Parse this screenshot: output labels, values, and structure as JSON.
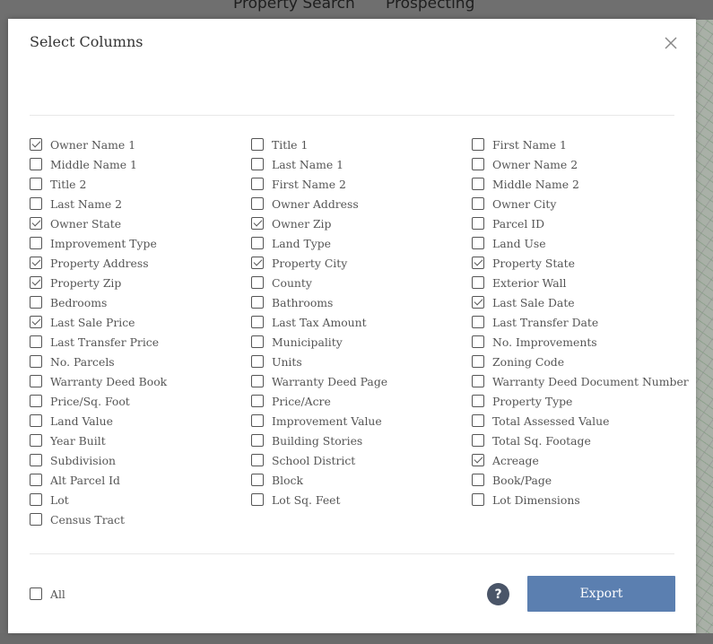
{
  "background": {
    "nav_links": [
      "Property Search",
      "Prospecting"
    ]
  },
  "modal": {
    "title": "Select Columns",
    "close_icon": "close-icon"
  },
  "columns": [
    [
      {
        "label": "Owner Name 1",
        "checked": true
      },
      {
        "label": "Middle Name 1",
        "checked": false
      },
      {
        "label": "Title 2",
        "checked": false
      },
      {
        "label": "Last Name 2",
        "checked": false
      },
      {
        "label": "Owner State",
        "checked": true
      },
      {
        "label": "Improvement Type",
        "checked": false
      },
      {
        "label": "Property Address",
        "checked": true
      },
      {
        "label": "Property Zip",
        "checked": true
      },
      {
        "label": "Bedrooms",
        "checked": false
      },
      {
        "label": "Last Sale Price",
        "checked": true
      },
      {
        "label": "Last Transfer Price",
        "checked": false
      },
      {
        "label": "No. Parcels",
        "checked": false
      },
      {
        "label": "Warranty Deed Book",
        "checked": false
      },
      {
        "label": "Price/Sq. Foot",
        "checked": false
      },
      {
        "label": "Land Value",
        "checked": false
      },
      {
        "label": "Year Built",
        "checked": false
      },
      {
        "label": "Subdivision",
        "checked": false
      },
      {
        "label": "Alt Parcel Id",
        "checked": false
      },
      {
        "label": "Lot",
        "checked": false
      },
      {
        "label": "Census Tract",
        "checked": false
      }
    ],
    [
      {
        "label": "Title 1",
        "checked": false
      },
      {
        "label": "Last Name 1",
        "checked": false
      },
      {
        "label": "First Name 2",
        "checked": false
      },
      {
        "label": "Owner Address",
        "checked": false
      },
      {
        "label": "Owner Zip",
        "checked": true
      },
      {
        "label": "Land Type",
        "checked": false
      },
      {
        "label": "Property City",
        "checked": true
      },
      {
        "label": "County",
        "checked": false
      },
      {
        "label": "Bathrooms",
        "checked": false
      },
      {
        "label": "Last Tax Amount",
        "checked": false
      },
      {
        "label": "Municipality",
        "checked": false
      },
      {
        "label": "Units",
        "checked": false
      },
      {
        "label": "Warranty Deed Page",
        "checked": false
      },
      {
        "label": "Price/Acre",
        "checked": false
      },
      {
        "label": "Improvement Value",
        "checked": false
      },
      {
        "label": "Building Stories",
        "checked": false
      },
      {
        "label": "School District",
        "checked": false
      },
      {
        "label": "Block",
        "checked": false
      },
      {
        "label": "Lot Sq. Feet",
        "checked": false
      }
    ],
    [
      {
        "label": "First Name 1",
        "checked": false
      },
      {
        "label": "Owner Name 2",
        "checked": false
      },
      {
        "label": "Middle Name 2",
        "checked": false
      },
      {
        "label": "Owner City",
        "checked": false
      },
      {
        "label": "Parcel ID",
        "checked": false
      },
      {
        "label": "Land Use",
        "checked": false
      },
      {
        "label": "Property State",
        "checked": true
      },
      {
        "label": "Exterior Wall",
        "checked": false
      },
      {
        "label": "Last Sale Date",
        "checked": true
      },
      {
        "label": "Last Transfer Date",
        "checked": false
      },
      {
        "label": "No. Improvements",
        "checked": false
      },
      {
        "label": "Zoning Code",
        "checked": false
      },
      {
        "label": "Warranty Deed Document Number",
        "checked": false
      },
      {
        "label": "Property Type",
        "checked": false
      },
      {
        "label": "Total Assessed Value",
        "checked": false
      },
      {
        "label": "Total Sq. Footage",
        "checked": false
      },
      {
        "label": "Acreage",
        "checked": true
      },
      {
        "label": "Book/Page",
        "checked": false
      },
      {
        "label": "Lot Dimensions",
        "checked": false
      }
    ]
  ],
  "footer": {
    "all_label": "All",
    "all_checked": false,
    "help_label": "?",
    "export_label": "Export"
  },
  "colors": {
    "export_button": "#5b7fb0",
    "help_button": "#4a5568",
    "overlay": "#6d6d6d"
  }
}
